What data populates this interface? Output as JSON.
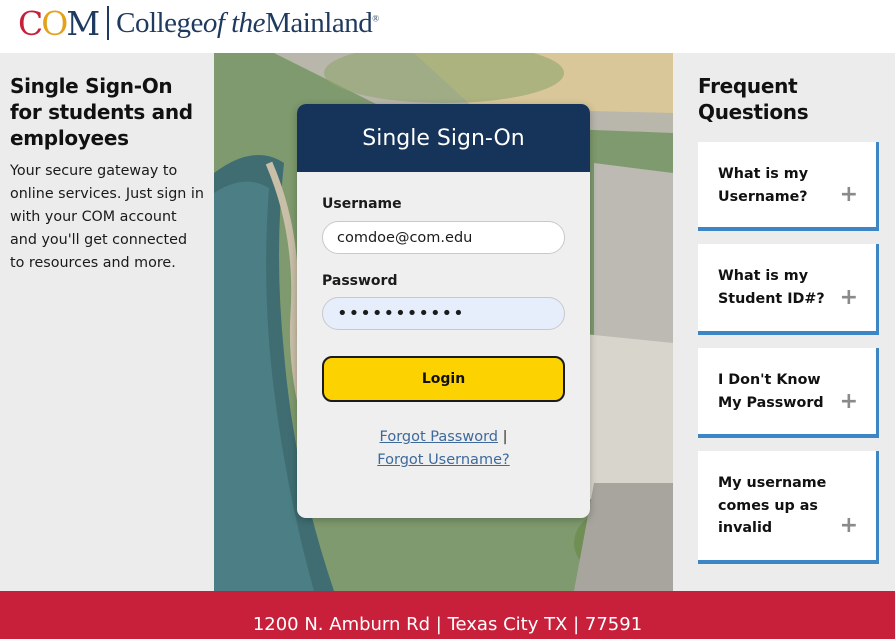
{
  "header": {
    "logo_com_text": "COM",
    "logo_college": "College",
    "logo_of_the": "of the",
    "logo_mainland": "Mainland",
    "logo_mark": "®",
    "colors": {
      "com_red": "#c8203b",
      "com_gold": "#e3a21a",
      "com_navy": "#1f3a5f"
    }
  },
  "left": {
    "title": "Single Sign-On for students and employees",
    "description": "Your secure gateway to online services. Just sign in with your COM account and you'll get connected to resources and more."
  },
  "login": {
    "title": "Single Sign-On",
    "username_label": "Username",
    "username_value": "comdoe@com.edu",
    "password_label": "Password",
    "password_value": "•••••••••••",
    "login_button": "Login",
    "forgot_password": "Forgot Password",
    "separator": "|",
    "forgot_username": "Forgot Username?",
    "colors": {
      "header_bg": "#16335a",
      "button_bg": "#fcd200",
      "link": "#3d6a9b"
    }
  },
  "faq": {
    "title": "Frequent Questions",
    "items": [
      {
        "label": "What is my Username?",
        "icon": "plus-icon"
      },
      {
        "label": "What is my Student ID#?",
        "icon": "plus-icon"
      },
      {
        "label": "I Don't Know My Password",
        "icon": "plus-icon"
      },
      {
        "label": "My username comes up as invalid",
        "icon": "plus-icon"
      }
    ],
    "colors": {
      "accent": "#3d86c6"
    }
  },
  "footer": {
    "address": "1200 N. Amburn Rd | Texas City TX | 77591",
    "colors": {
      "bg": "#c8203b"
    }
  }
}
